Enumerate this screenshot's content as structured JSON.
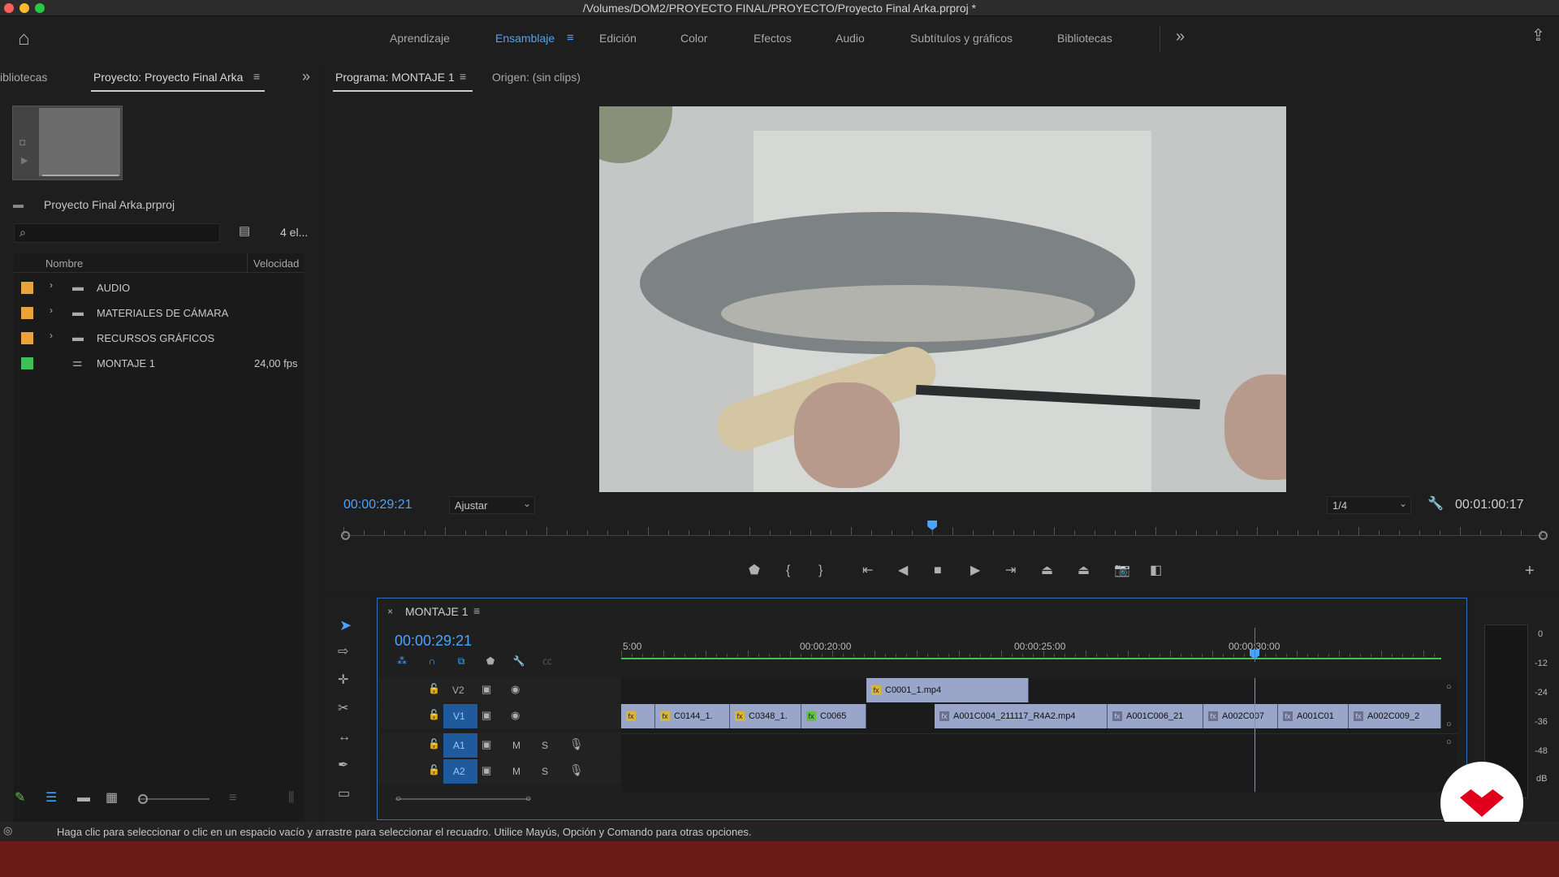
{
  "window": {
    "title": "/Volumes/DOM2/PROYECTO FINAL/PROYECTO/Proyecto Final Arka.prproj *"
  },
  "workspaces": [
    {
      "label": "Aprendizaje"
    },
    {
      "label": "Ensamblaje"
    },
    {
      "label": "Edición"
    },
    {
      "label": "Color"
    },
    {
      "label": "Efectos"
    },
    {
      "label": "Audio"
    },
    {
      "label": "Subtítulos y gráficos"
    },
    {
      "label": "Bibliotecas"
    }
  ],
  "project_panel": {
    "tab_libraries": "ibliotecas",
    "tab_project": "Proyecto: Proyecto Final Arka",
    "project_file": "Proyecto Final Arka.prproj",
    "item_count": "4 el...",
    "search_placeholder": "",
    "columns": {
      "name": "Nombre",
      "speed": "Velocidad"
    },
    "items": [
      {
        "name": "AUDIO",
        "speed": "",
        "color": "#e8a33d"
      },
      {
        "name": "MATERIALES DE CÁMARA",
        "speed": "",
        "color": "#e8a33d"
      },
      {
        "name": "RECURSOS GRÁFICOS",
        "speed": "",
        "color": "#e8a33d"
      },
      {
        "name": "MONTAJE 1",
        "speed": "24,00 fps",
        "color": "#3fbf56"
      }
    ]
  },
  "program_monitor": {
    "tab_program": "Programa: MONTAJE 1",
    "tab_source": "Origen: (sin clips)",
    "timecode": "00:00:29:21",
    "fit": "Ajustar",
    "resolution": "1/4",
    "duration": "00:01:00:17",
    "playhead_fraction": 0.49
  },
  "timeline": {
    "tab": "MONTAJE 1",
    "timecode": "00:00:29:21",
    "ruler": [
      "5:00",
      "00:00:20:00",
      "00:00:25:00",
      "00:00:30:00"
    ],
    "tracks": {
      "v2": "V2",
      "v1": "V1",
      "a1": "A1",
      "a2": "A2",
      "mute": "M",
      "solo": "S"
    },
    "v2_clips": [
      {
        "name": "C0001_1.mp4"
      }
    ],
    "v1_clips": [
      {
        "name": ""
      },
      {
        "name": "C0144_1."
      },
      {
        "name": "C0348_1."
      },
      {
        "name": "C0065"
      },
      {
        "name": "A001C004_211117_R4A2.mp4"
      },
      {
        "name": "A001C006_21"
      },
      {
        "name": "A002C007"
      },
      {
        "name": "A001C01"
      },
      {
        "name": "A002C009_2"
      }
    ]
  },
  "meter": {
    "scale": [
      "0",
      "-12",
      "-24",
      "-36",
      "-48",
      "dB"
    ]
  },
  "status_bar": {
    "text": "Haga clic para seleccionar o clic en un espacio vacío y arrastre para seleccionar el recuadro. Utilice Mayús, Opción y Comando para otras opciones."
  },
  "colors": {
    "accent": "#4aa3ff",
    "brand": "#e0001b",
    "clip": "#9aa6c9",
    "bottom_band": "#6b1a18"
  }
}
